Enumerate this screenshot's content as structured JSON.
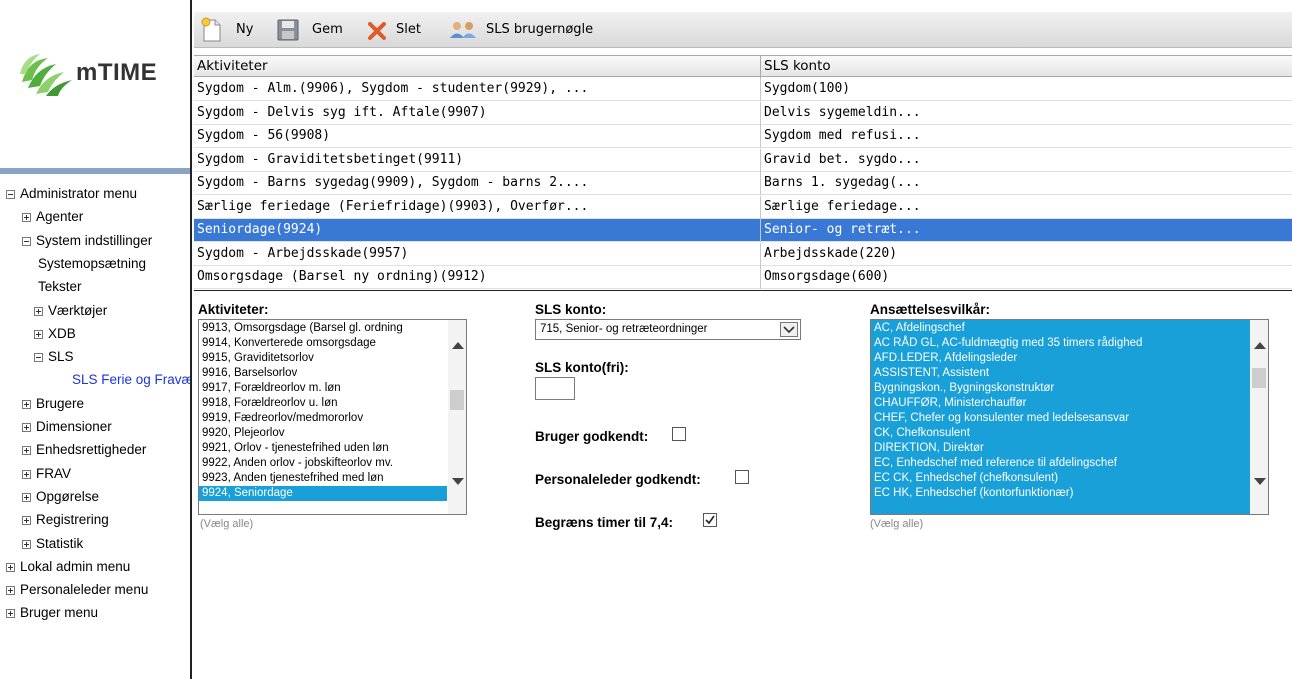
{
  "logo": {
    "text": "mTIME"
  },
  "nav": {
    "items": [
      {
        "label": "Administrator menu",
        "icon": "minus-box-icon",
        "indent": 0
      },
      {
        "label": "Agenter",
        "icon": "plus-box-icon",
        "indent": 1
      },
      {
        "label": "System indstillinger",
        "icon": "minus-box-icon",
        "indent": 1
      },
      {
        "label": "Systemopsætning",
        "icon": "",
        "indent": 2
      },
      {
        "label": "Tekster",
        "icon": "",
        "indent": 2
      },
      {
        "label": "Værktøjer",
        "icon": "plus-box-icon",
        "indent": 2
      },
      {
        "label": "XDB",
        "icon": "plus-box-icon",
        "indent": 2
      },
      {
        "label": "SLS",
        "icon": "minus-box-icon",
        "indent": 2
      },
      {
        "label": "SLS Ferie og Fravær",
        "icon": "",
        "indent": 3,
        "selected": true
      },
      {
        "label": "Brugere",
        "icon": "plus-box-icon",
        "indent": 1
      },
      {
        "label": "Dimensioner",
        "icon": "plus-box-icon",
        "indent": 1
      },
      {
        "label": "Enhedsrettigheder",
        "icon": "plus-box-icon",
        "indent": 1
      },
      {
        "label": "FRAV",
        "icon": "plus-box-icon",
        "indent": 1
      },
      {
        "label": "Opgørelse",
        "icon": "plus-box-icon",
        "indent": 1
      },
      {
        "label": "Registrering",
        "icon": "plus-box-icon",
        "indent": 1
      },
      {
        "label": "Statistik",
        "icon": "plus-box-icon",
        "indent": 1
      },
      {
        "label": "Lokal admin menu",
        "icon": "plus-box-icon",
        "indent": 0
      },
      {
        "label": "Personaleleder menu",
        "icon": "plus-box-icon",
        "indent": 0
      },
      {
        "label": "Bruger menu",
        "icon": "plus-box-icon",
        "indent": 0
      }
    ]
  },
  "toolbar": {
    "new_label": "Ny",
    "save_label": "Gem",
    "delete_label": "Slet",
    "sls_key_label": "SLS brugernøgle"
  },
  "grid": {
    "columns": [
      "Aktiviteter",
      "SLS konto"
    ],
    "rows": [
      [
        "Sygdom - Alm.(9906), Sygdom - studenter(9929), ...",
        "Sygdom(100)"
      ],
      [
        "Sygdom - Delvis syg ift. Aftale(9907)",
        "Delvis sygemeldin..."
      ],
      [
        "Sygdom - 56(9908)",
        "Sygdom med refusi..."
      ],
      [
        "Sygdom - Graviditetsbetinget(9911)",
        "Gravid bet. sygdo..."
      ],
      [
        "Sygdom - Barns sygedag(9909), Sygdom - barns 2....",
        "Barns 1. sygedag(..."
      ],
      [
        "Særlige feriedage (Feriefridage)(9903), Overfør...",
        "Særlige feriedage..."
      ],
      [
        "Seniordage(9924)",
        "Senior- og retræt..."
      ],
      [
        "Sygdom - Arbejdsskade(9957)",
        "Arbejdsskade(220)"
      ],
      [
        "Omsorgsdage (Barsel ny ordning)(9912)",
        "Omsorgsdage(600)"
      ]
    ],
    "selected_row": 6
  },
  "form": {
    "aktiviteter_label": "Aktiviteter:",
    "aktiviteter_items": [
      "9913, Omsorgsdage (Barsel gl. ordning",
      "9914, Konverterede omsorgsdage",
      "9915, Graviditetsorlov",
      "9916, Barselsorlov",
      "9917, Forældreorlov m. løn",
      "9918, Forældreorlov u. løn",
      "9919, Fædreorlov/medmororlov",
      "9920, Plejeorlov",
      "9921, Orlov - tjenestefrihed uden løn",
      "9922, Anden orlov - jobskifteorlov mv.",
      "9923, Anden tjenestefrihed med løn",
      "9924, Seniordage"
    ],
    "aktiviteter_selected": 11,
    "select_all_left": "(Vælg alle)",
    "sls_konto_label": "SLS konto:",
    "sls_konto_value": "715, Senior- og retræteordninger",
    "sls_konto_fri_label": "SLS konto(fri):",
    "sls_konto_fri_value": "",
    "bruger_godkendt_label": "Bruger godkendt:",
    "bruger_godkendt": false,
    "personaleleder_label": "Personaleleder godkendt:",
    "personaleleder_godkendt": false,
    "begraens_label": "Begræns timer til 7,4:",
    "begraens": true,
    "ansaettelse_label": "Ansættelsesvilkår:",
    "ansaettelse_items": [
      "AC, Afdelingschef",
      "AC RÅD GL, AC-fuldmægtig med 35 timers rådighed",
      "AFD.LEDER, Afdelingsleder",
      "ASSISTENT, Assistent",
      "Bygningskon., Bygningskonstruktør",
      "CHAUFFØR, Ministerchauffør",
      "CHEF, Chefer og konsulenter med ledelsesansvar",
      "CK, Chefkonsulent",
      "DIREKTION, Direktør",
      "EC, Enhedschef med reference til afdelingschef",
      "EC CK, Enhedschef (chefkonsulent)",
      "EC HK, Enhedschef (kontorfunktionær)"
    ],
    "select_all_right": "(Vælg alle)"
  },
  "colors": {
    "selection_blue": "#3a78d6",
    "list_highlight": "#19a0d8",
    "nav_selected": "#1b35d8",
    "logo_green": "#5cb85c"
  }
}
